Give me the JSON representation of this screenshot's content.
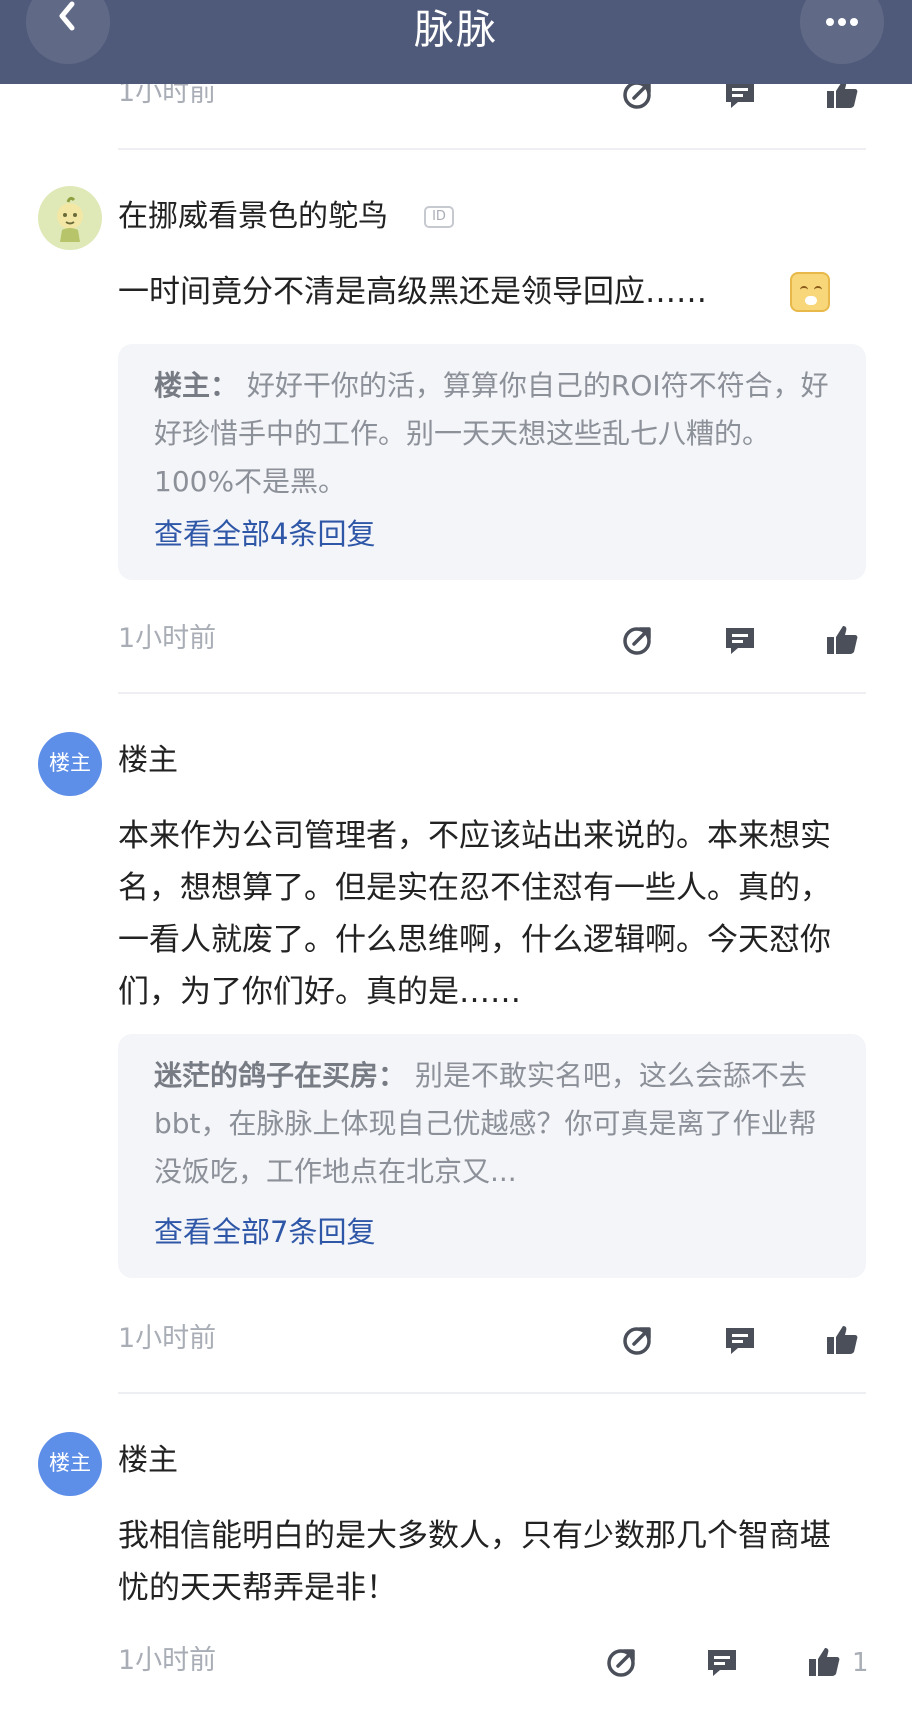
{
  "header": {
    "title": "脉脉",
    "back_icon": "chevron-left-icon",
    "more_icon": "more-horizontal-icon",
    "color": "#4f5a7a"
  },
  "items": [
    {
      "time": "1小时前"
    },
    {
      "author": "在挪威看景色的鸵鸟",
      "id_badge": "ID",
      "avatar_icon": "cartoon-avatar",
      "text": "一时间竟分不清是高级黑还是领导回应……",
      "emoji_icon": "laughing-emoji-icon",
      "reply": {
        "name": "楼主：",
        "text": "好好干你的活，算算你自己的ROI符不符合，好好珍惜手中的工作。别一天天想这些乱七八糟的。100%不是黑。",
        "link": "查看全部4条回复"
      },
      "time": "1小时前"
    },
    {
      "author": "楼主",
      "avatar_text": "楼主",
      "text": "本来作为公司管理者，不应该站出来说的。本来想实名，想想算了。但是实在忍不住怼有一些人。真的，一看人就废了。什么思维啊，什么逻辑啊。今天怼你们，为了你们好。真的是……",
      "reply": {
        "name": "迷茫的鸽子在买房：",
        "text": "别是不敢实名吧，这么会舔不去bbt，在脉脉上体现自己优越感？你可真是离了作业帮没饭吃，工作地点在北京又...",
        "link": "查看全部7条回复"
      },
      "time": "1小时前"
    },
    {
      "author": "楼主",
      "avatar_text": "楼主",
      "text": "我相信能明白的是大多数人，只有少数那几个智商堪忧的天天帮弄是非！",
      "time": "1小时前",
      "like_count": "1"
    }
  ],
  "actions": {
    "share_icon": "share-icon",
    "comment_icon": "comment-icon",
    "like_icon": "thumbs-up-icon"
  },
  "colors": {
    "link": "#2f57a8",
    "avatar_op": "#5d8ee8",
    "muted": "#a9adb6"
  }
}
